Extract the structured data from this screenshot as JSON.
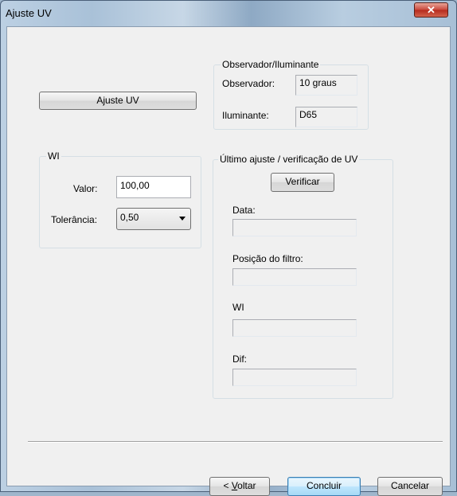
{
  "window": {
    "title": "Ajuste UV",
    "close_glyph": "✕"
  },
  "adjust_button": {
    "label": "Ajuste UV"
  },
  "observer_group": {
    "legend": "Observador/Iluminante",
    "observer_label": "Observador:",
    "observer_value": "10 graus",
    "illuminant_label": "Iluminante:",
    "illuminant_value": "D65"
  },
  "wi_group": {
    "legend": "WI",
    "value_label": "Valor:",
    "value": "100,00",
    "tolerance_label": "Tolerância:",
    "tolerance_value": "0,50"
  },
  "last_group": {
    "legend": "Último ajuste / verificação de UV",
    "verify_button": "Verificar",
    "date_label": "Data:",
    "date_value": "",
    "filter_label": "Posição do filtro:",
    "filter_value": "",
    "wi_label": "WI",
    "wi_value": "",
    "dif_label": "Dif:",
    "dif_value": ""
  },
  "footer": {
    "back_prefix": "< ",
    "back_mnemonic": "V",
    "back_rest": "oltar",
    "finish": "Concluir",
    "cancel": "Cancelar"
  }
}
